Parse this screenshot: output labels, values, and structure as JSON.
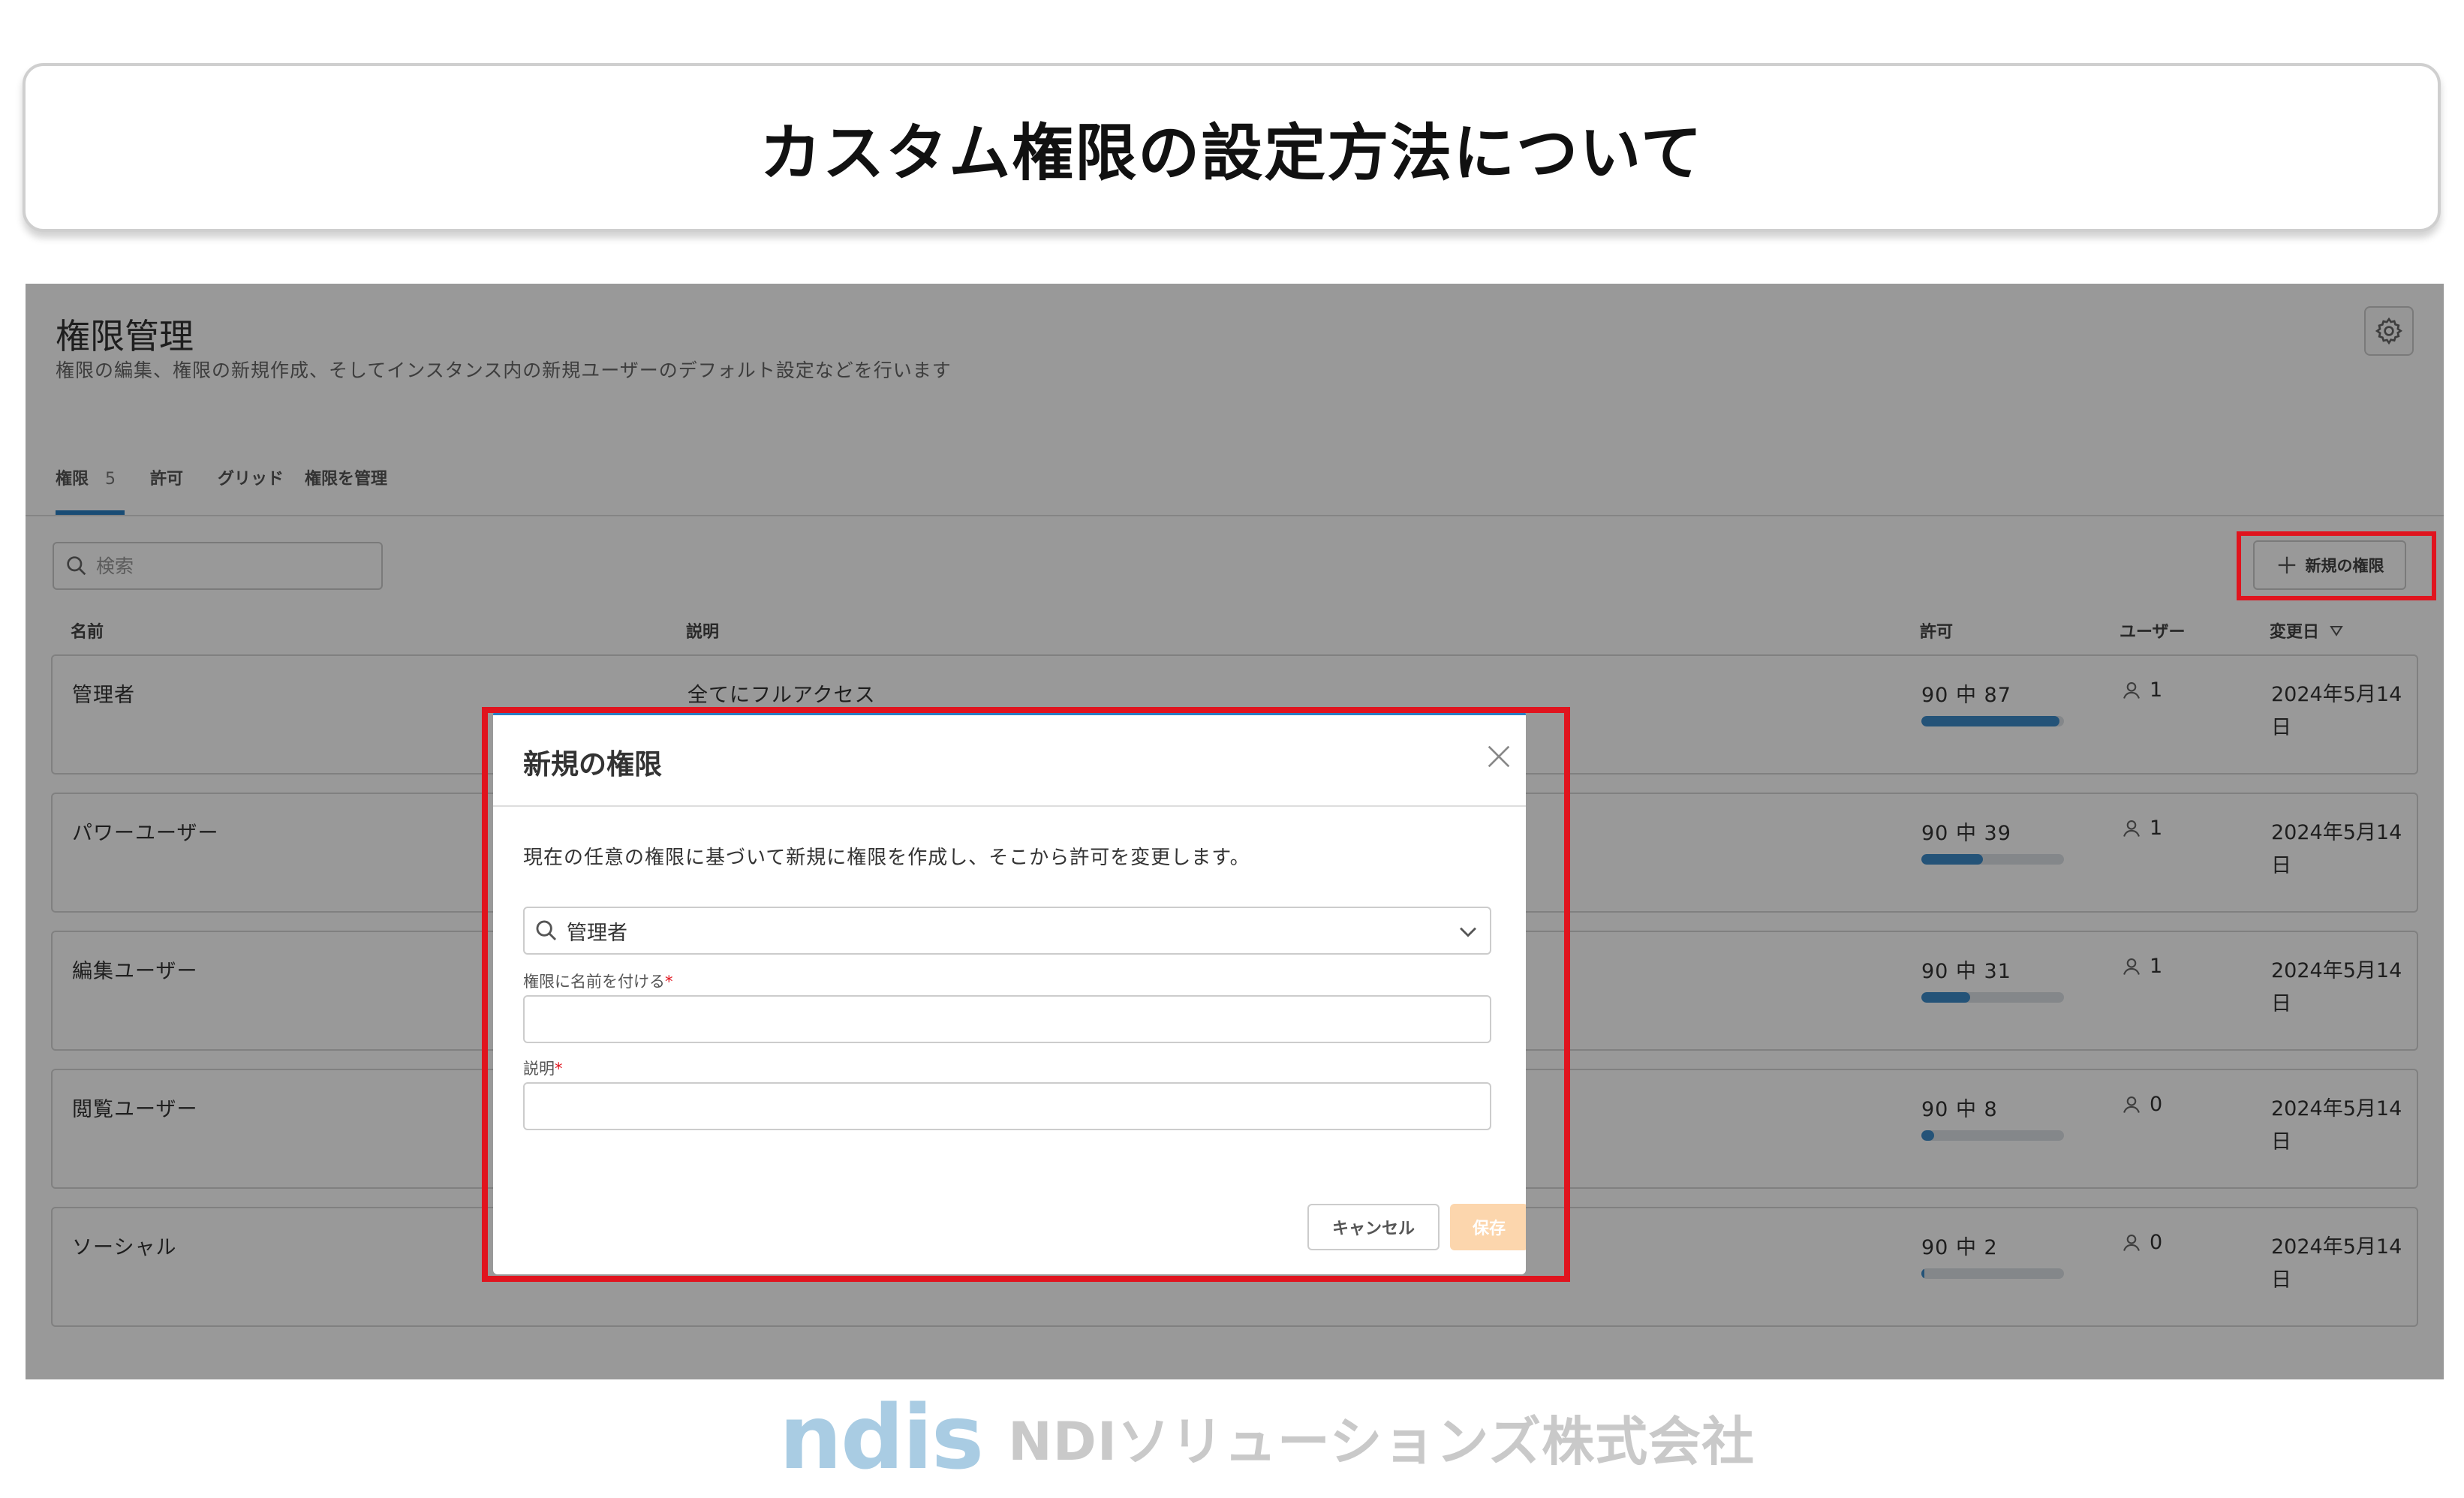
{
  "slide": {
    "title": "カスタム権限の設定方法について"
  },
  "header": {
    "title": "権限管理",
    "subtitle": "権限の編集、権限の新規作成、そしてインスタンス内の新規ユーザーのデフォルト設定などを行います"
  },
  "tabs": [
    {
      "label": "権限",
      "count": "5",
      "active": true
    },
    {
      "label": "許可"
    },
    {
      "label": "グリッド"
    },
    {
      "label": "権限を管理"
    }
  ],
  "search": {
    "placeholder": "検索"
  },
  "toolbar": {
    "new_permission_label": "新規の権限"
  },
  "table": {
    "headers": {
      "name": "名前",
      "description": "説明",
      "permissions": "許可",
      "users": "ユーザー",
      "modified": "変更日"
    },
    "rows": [
      {
        "name": "管理者",
        "description": "全てにフルアクセス",
        "permission_text": "90 中 87",
        "permission_fraction": 0.967,
        "users": "1",
        "modified": "2024年5月14日"
      },
      {
        "name": "パワーユーザー",
        "description": "",
        "permission_text": "90 中 39",
        "permission_fraction": 0.433,
        "users": "1",
        "modified": "2024年5月14日"
      },
      {
        "name": "編集ユーザー",
        "description": "",
        "permission_text": "90 中 31",
        "permission_fraction": 0.344,
        "users": "1",
        "modified": "2024年5月14日"
      },
      {
        "name": "閲覧ユーザー",
        "description": "",
        "permission_text": "90 中 8",
        "permission_fraction": 0.089,
        "users": "0",
        "modified": "2024年5月14日"
      },
      {
        "name": "ソーシャル",
        "description": "",
        "permission_text": "90 中 2",
        "permission_fraction": 0.022,
        "users": "0",
        "modified": "2024年5月14日"
      }
    ]
  },
  "modal": {
    "title": "新規の権限",
    "description": "現在の任意の権限に基づいて新規に権限を作成し、そこから許可を変更します。",
    "base_select_value": "管理者",
    "name_label": "権限に名前を付ける",
    "description_label": "説明",
    "required_mark": "*",
    "cancel_label": "キャンセル",
    "save_label": "保存"
  },
  "footer": {
    "logo": "ndis",
    "company": "NDIソリューションズ株式会社"
  },
  "colors": {
    "accent": "#2b7fc4",
    "highlight": "#e0141e",
    "save_disabled": "#fcd6ad"
  }
}
